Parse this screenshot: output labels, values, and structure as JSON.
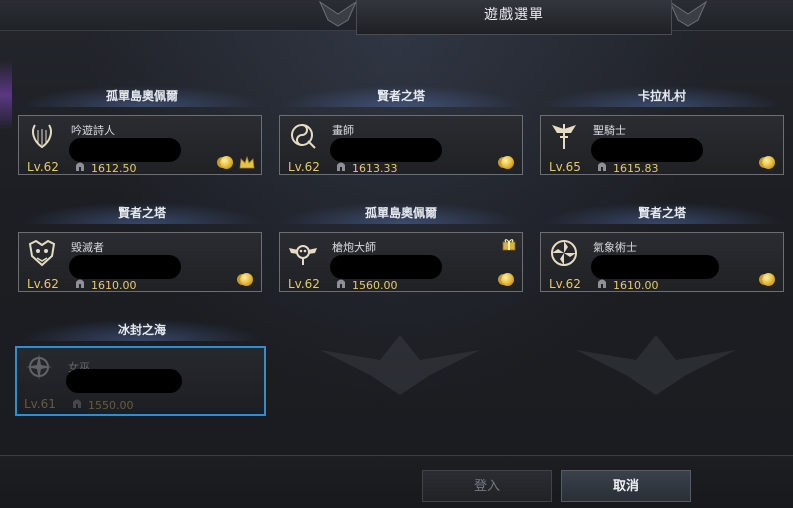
{
  "dialog": {
    "title": "遊戲選單"
  },
  "characters": [
    {
      "region": "孤單島奧佩爾",
      "class": "吟遊詩人",
      "level": "Lv.62",
      "item_level": "1612.50",
      "icon": "lyre-icon",
      "badges": [
        "coin",
        "crown"
      ],
      "selected": false
    },
    {
      "region": "賢者之塔",
      "class": "畫師",
      "level": "Lv.62",
      "item_level": "1613.33",
      "icon": "yin-yang-brush-icon",
      "badges": [
        "coin"
      ],
      "selected": false
    },
    {
      "region": "卡拉札村",
      "class": "聖騎士",
      "level": "Lv.65",
      "item_level": "1615.83",
      "icon": "winged-sword-icon",
      "badges": [
        "coin"
      ],
      "selected": false
    },
    {
      "region": "賢者之塔",
      "class": "毀滅者",
      "level": "Lv.62",
      "item_level": "1610.00",
      "icon": "beast-crest-icon",
      "badges": [
        "coin"
      ],
      "selected": false
    },
    {
      "region": "孤單島奧佩爾",
      "class": "槍炮大師",
      "level": "Lv.62",
      "item_level": "1560.00",
      "icon": "winged-skull-icon",
      "badges": [
        "coin",
        "gift"
      ],
      "selected": false
    },
    {
      "region": "賢者之塔",
      "class": "氣象術士",
      "level": "Lv.62",
      "item_level": "1610.00",
      "icon": "windmill-icon",
      "badges": [
        "coin"
      ],
      "selected": false
    },
    {
      "region": "冰封之海",
      "class": "女巫",
      "level": "Lv.61",
      "item_level": "1550.00",
      "icon": "arcane-star-icon",
      "badges": [],
      "selected": true
    }
  ],
  "buttons": {
    "login": "登入",
    "cancel": "取消"
  },
  "colors": {
    "level_gold": "#e8c96a",
    "selection_blue": "#2e8fd0",
    "frame_gray": "#6b6e74"
  }
}
